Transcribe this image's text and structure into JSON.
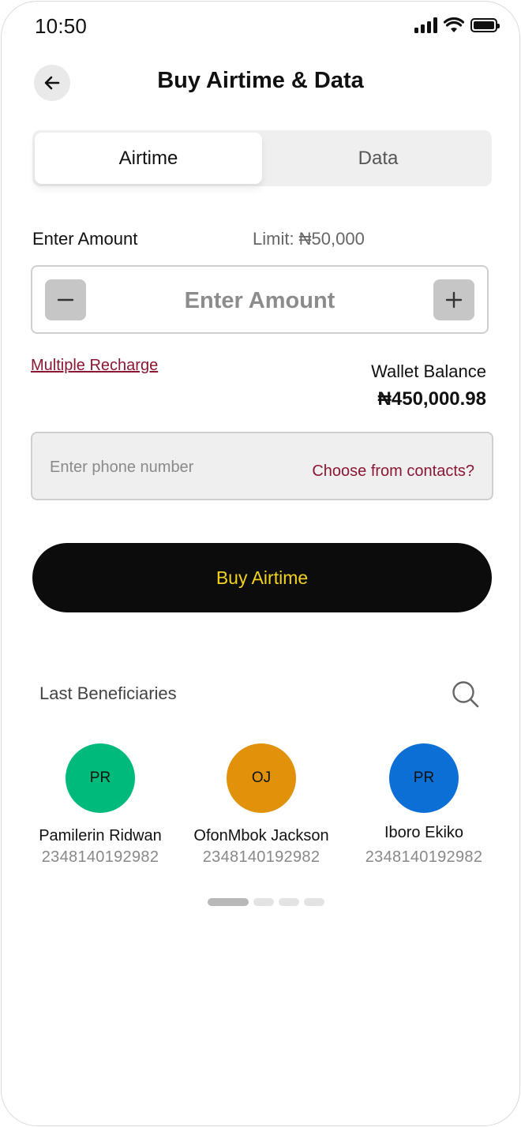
{
  "status_bar": {
    "time": "10:50"
  },
  "header": {
    "title": "Buy Airtime & Data"
  },
  "tabs": [
    {
      "label": "Airtime",
      "active": true
    },
    {
      "label": "Data",
      "active": false
    }
  ],
  "amount": {
    "label": "Enter Amount",
    "limit": "Limit: ₦50,000",
    "placeholder": "Enter Amount",
    "value": ""
  },
  "multiple_recharge": "Multiple Recharge",
  "wallet": {
    "label": "Wallet Balance",
    "value": "₦450,000.98"
  },
  "phone": {
    "placeholder": "Enter phone number",
    "value": "",
    "contacts_link": "Choose from contacts?"
  },
  "buy_button": "Buy Airtime",
  "beneficiaries": {
    "title": "Last Beneficiaries",
    "items": [
      {
        "initials": "PR",
        "name": "Pamilerin Ridwan",
        "phone": "2348140192982",
        "color": "#00ba7c"
      },
      {
        "initials": "OJ",
        "name": "OfonMbok Jackson",
        "phone": "2348140192982",
        "color": "#e1920a"
      },
      {
        "initials": "PR",
        "name": "Iboro Ekiko",
        "phone": "2348140192982",
        "color": "#0b6fd6"
      }
    ]
  },
  "colors": {
    "accent": "#8a1733",
    "button_bg": "#0c0c0c",
    "button_text": "#f2d21c"
  },
  "pagination": {
    "pages": 4,
    "current": 1
  }
}
